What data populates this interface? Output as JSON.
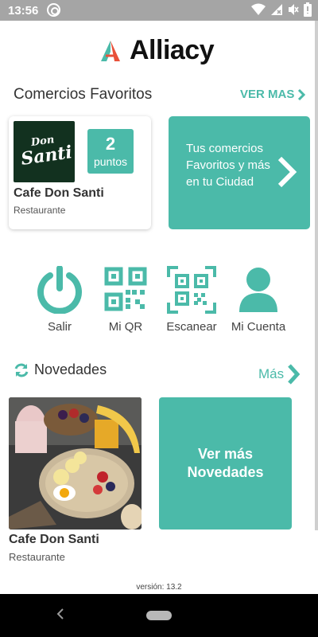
{
  "status_bar": {
    "time": "13:56"
  },
  "app": {
    "brand_name": "Alliacy",
    "favorites": {
      "title": "Comercios Favoritos",
      "see_more": "VER MAS",
      "card": {
        "logo_text_line1": "Don",
        "logo_text_line2": "Santi",
        "points_value": "2",
        "points_label": "puntos",
        "name": "Cafe Don Santi",
        "type": "Restaurante"
      },
      "promo_text": "Tus comercios Favoritos y más en tu Ciudad"
    },
    "actions": [
      {
        "label": "Salir",
        "icon": "power-icon"
      },
      {
        "label": "Mi QR",
        "icon": "qr-code-icon"
      },
      {
        "label": "Escanear",
        "icon": "scan-qr-icon"
      },
      {
        "label": "Mi Cuenta",
        "icon": "user-icon"
      }
    ],
    "news": {
      "title": "Novedades",
      "more": "Más",
      "card": {
        "name": "Cafe Don Santi",
        "type": "Restaurante"
      },
      "see_more_news": "Ver más Novedades"
    },
    "version": "versión: 13.2"
  },
  "colors": {
    "accent": "#4bbaa9",
    "status_bar": "#a5a5a5",
    "nav_bar": "#000000"
  }
}
